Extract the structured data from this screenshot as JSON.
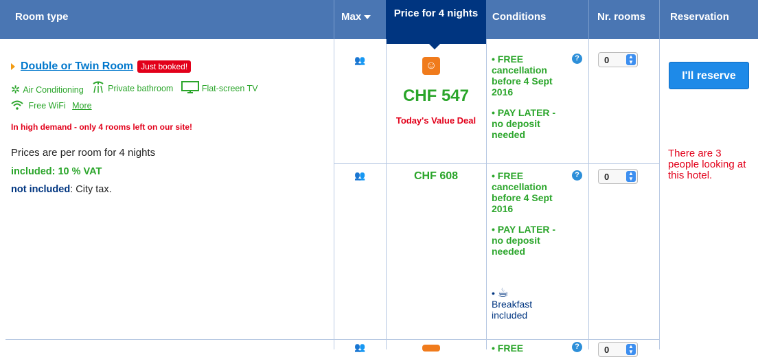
{
  "header": {
    "room_type": "Room type",
    "max": "Max",
    "price": "Price for 4 nights",
    "conditions": "Conditions",
    "nr_rooms": "Nr. rooms",
    "reservation": "Reservation"
  },
  "room": {
    "name": "Double or Twin Room",
    "badge": "Just booked!",
    "facilities": [
      "Air Conditioning",
      "Private bathroom",
      "Flat-screen TV",
      "Free WiFi"
    ],
    "more_link": "More",
    "demand": "In high demand - only 4 rooms left on our site!",
    "prices_note": "Prices are per room for 4 nights",
    "included": "included: 10 % VAT",
    "not_included_label": "not included",
    "not_included_value": ": City tax."
  },
  "offers": [
    {
      "price": "CHF 547",
      "deal": "Today's Value Deal",
      "cond_free": "• FREE cancellation before 4 Sept 2016",
      "cond_pay": "• PAY LATER - no deposit needed",
      "rooms_value": "0"
    },
    {
      "price": "CHF 608",
      "cond_free": "• FREE cancellation before 4 Sept 2016",
      "cond_pay": "• PAY LATER - no deposit needed",
      "breakfast": "Breakfast included",
      "rooms_value": "0"
    },
    {
      "cond_free_partial": "• FREE",
      "rooms_value": "0"
    }
  ],
  "reservation": {
    "button": "I'll reserve",
    "looking": "There are 3 people looking at this hotel."
  },
  "icons": {
    "air_conditioning": "snowflake-icon",
    "private_bathroom": "shower-icon",
    "tv": "tv-icon",
    "wifi": "wifi-icon",
    "persons": "persons-icon",
    "deal": "value-deal-icon",
    "info": "info-icon",
    "breakfast": "coffee-cup-icon"
  },
  "colors": {
    "header_bg": "#4a76b3",
    "price_header_bg": "#003580",
    "green": "#2aa52a",
    "red": "#e2001a",
    "button_blue": "#1e8ae8"
  }
}
